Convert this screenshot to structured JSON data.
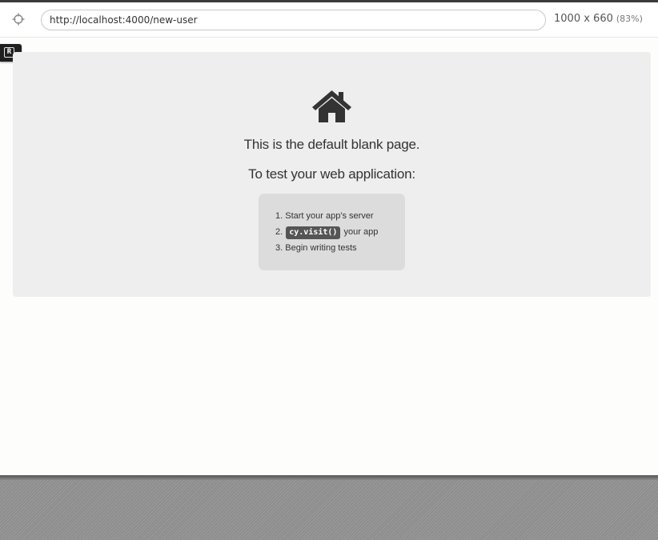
{
  "toolbar": {
    "url": "http://localhost:4000/new-user",
    "viewport_size": "1000 x 660",
    "viewport_scale": "(83%)",
    "selector_icon": "crosshair-icon"
  },
  "runner": {
    "rerun_badge_label": "R"
  },
  "blank_page": {
    "icon": "home-icon",
    "line1": "This is the default blank page.",
    "line2": "To test your web application:",
    "steps": [
      {
        "number": "1.",
        "text": "Start your app's server"
      },
      {
        "number": "2.",
        "code": "cy.visit()",
        "text": "your app"
      },
      {
        "number": "3.",
        "text": "Begin writing tests"
      }
    ]
  }
}
